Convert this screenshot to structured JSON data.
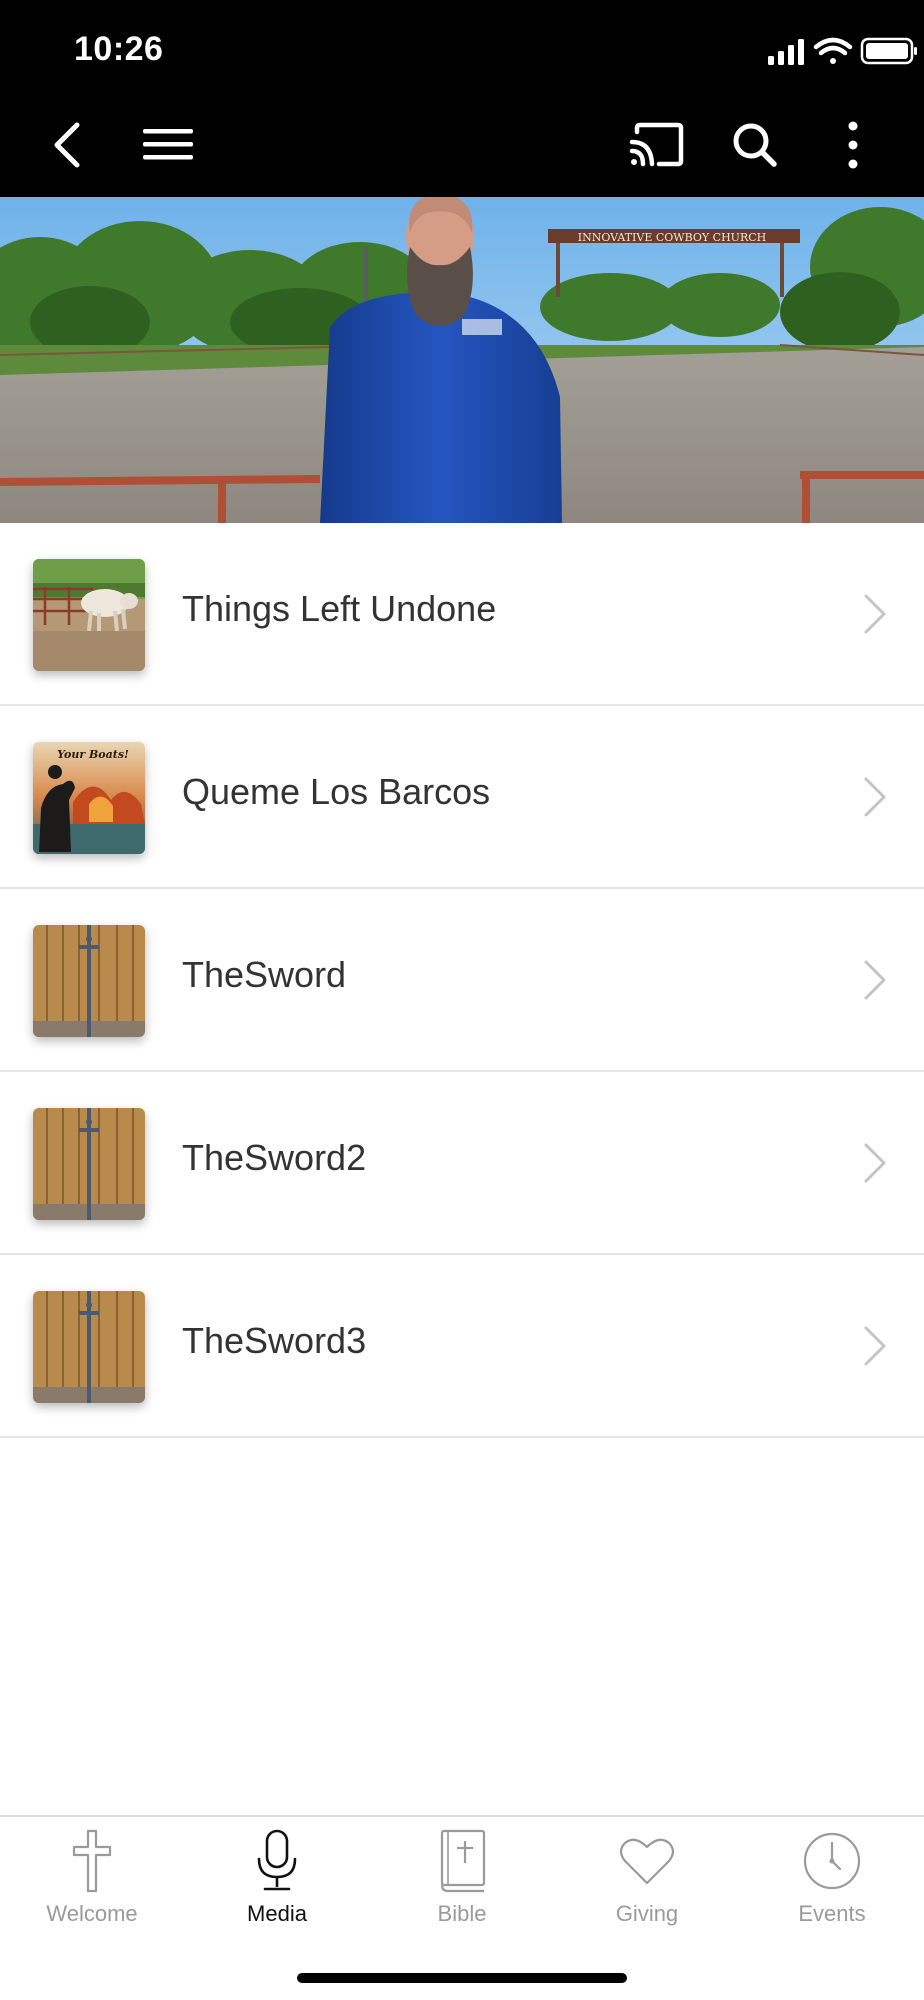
{
  "status": {
    "time": "10:26"
  },
  "nav": {
    "back_icon": "chevron-left-icon",
    "menu_icon": "hamburger-menu-icon",
    "cast_icon": "cast-icon",
    "search_icon": "search-icon",
    "more_icon": "more-vertical-icon"
  },
  "hero": {
    "sign_text": "INNOVATIVE COWBOY CHURCH"
  },
  "media_list": [
    {
      "title": "Things Left Undone",
      "thumb": "bull-in-pen"
    },
    {
      "title": "Queme Los Barcos",
      "thumb": "burning-boats",
      "thumb_text": "Your Boats!"
    },
    {
      "title": "TheSword",
      "thumb": "wooden-door-sword"
    },
    {
      "title": "TheSword2",
      "thumb": "wooden-door-sword"
    },
    {
      "title": "TheSword3",
      "thumb": "wooden-door-sword"
    }
  ],
  "tabs": [
    {
      "label": "Welcome",
      "icon": "cross-icon",
      "active": false
    },
    {
      "label": "Media",
      "icon": "microphone-icon",
      "active": true
    },
    {
      "label": "Bible",
      "icon": "bible-icon",
      "active": false
    },
    {
      "label": "Giving",
      "icon": "heart-icon",
      "active": false
    },
    {
      "label": "Events",
      "icon": "clock-icon",
      "active": false
    }
  ],
  "colors": {
    "topbar": "#000000",
    "active_tab": "#111111",
    "inactive_tab": "#9a9a9a",
    "row_text": "#333333"
  }
}
